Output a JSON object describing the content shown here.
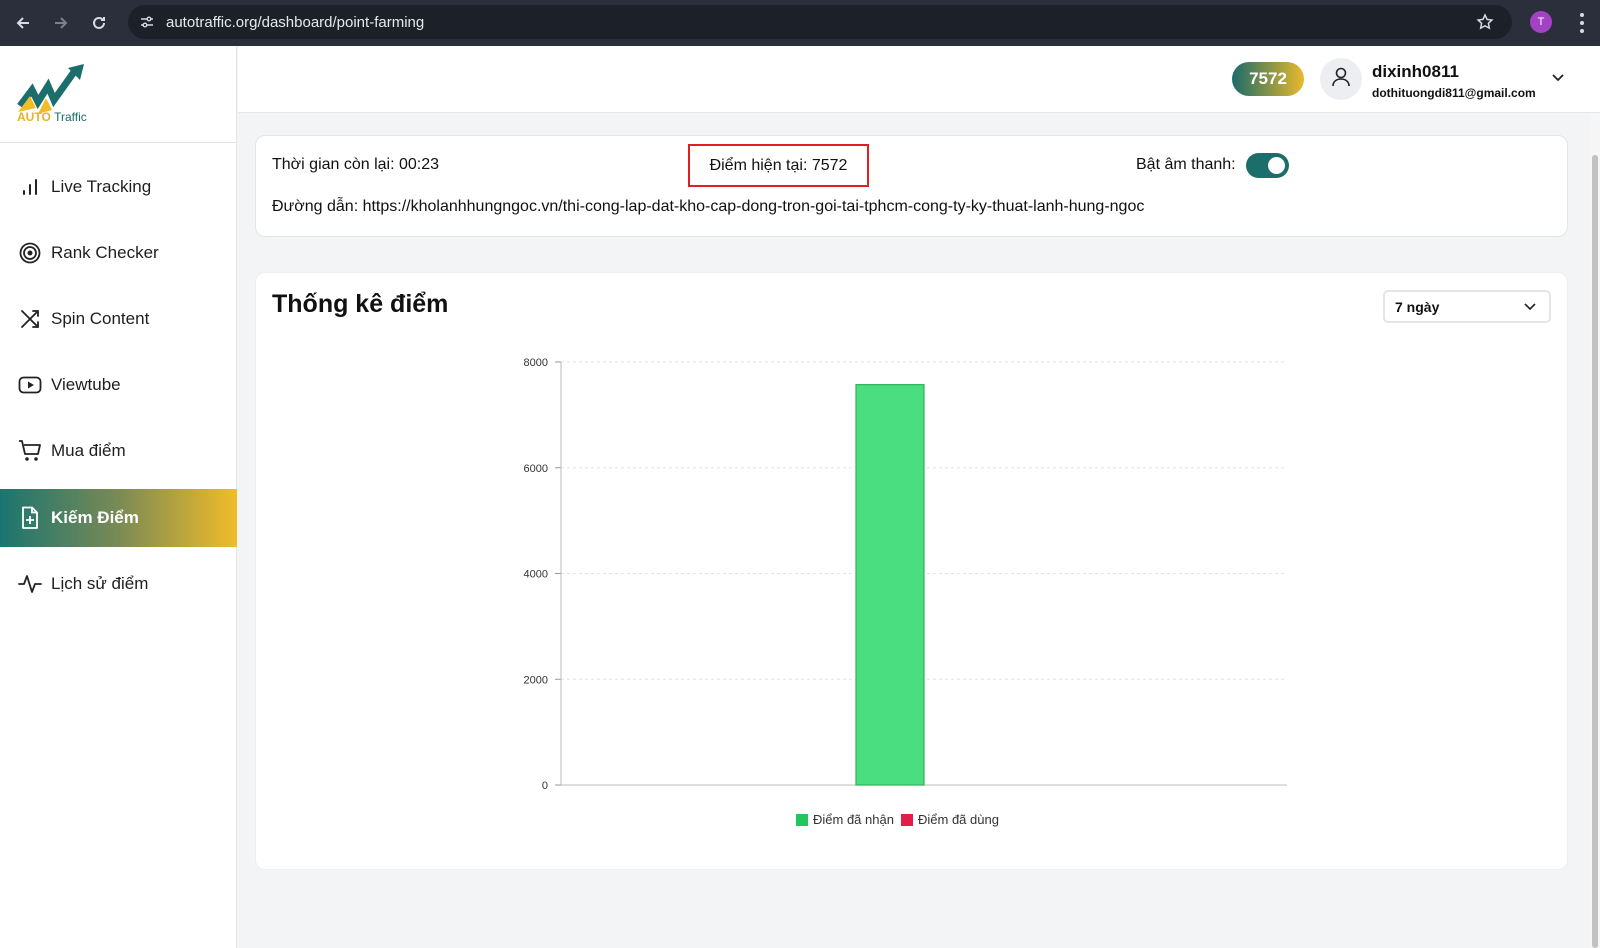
{
  "browser": {
    "url": "autotraffic.org/dashboard/point-farming",
    "profile_initial": "T"
  },
  "logo": {
    "part1": "AUTO",
    "part2": "Traffic"
  },
  "sidebar": {
    "items": [
      {
        "label": "Live Tracking",
        "icon": "bar-chart-icon"
      },
      {
        "label": "Rank Checker",
        "icon": "target-icon"
      },
      {
        "label": "Spin Content",
        "icon": "shuffle-icon"
      },
      {
        "label": "Viewtube",
        "icon": "youtube-icon"
      },
      {
        "label": "Mua điểm",
        "icon": "cart-icon"
      },
      {
        "label": "Kiếm Điểm",
        "icon": "file-plus-icon",
        "active": true
      },
      {
        "label": "Lịch sử điểm",
        "icon": "activity-icon"
      }
    ]
  },
  "header": {
    "points": "7572",
    "username": "dixinh0811",
    "email": "dothituongdi811@gmail.com"
  },
  "info": {
    "timer": "Thời gian còn lại: 00:23",
    "current_points": "Điểm hiện tại: 7572",
    "sound_label": "Bật âm thanh:",
    "sound_on": true,
    "path": "Đường dẫn: https://kholanhhungngoc.vn/thi-cong-lap-dat-kho-cap-dong-tron-goi-tai-tphcm-cong-ty-ky-thuat-lanh-hung-ngoc"
  },
  "stats": {
    "title": "Thống kê điểm",
    "range": "7 ngày"
  },
  "colors": {
    "accent": "#1b6e6a",
    "gold": "#f0bc2a",
    "received": "#22c55e",
    "used": "#e11d48"
  },
  "chart_data": {
    "type": "bar",
    "ylim": [
      0,
      8000
    ],
    "yticks": [
      "8000",
      "6000",
      "4000",
      "2000",
      "0"
    ],
    "grid": true,
    "series": [
      {
        "name": "Điểm đã nhận",
        "color": "#4ade80",
        "values": [
          7572
        ]
      },
      {
        "name": "Điểm đã dùng",
        "color": "#f43f5e",
        "values": [
          0
        ]
      }
    ],
    "legend": [
      "Điểm đã nhận",
      "Điểm đã dùng"
    ],
    "legend_position": "bottom"
  }
}
